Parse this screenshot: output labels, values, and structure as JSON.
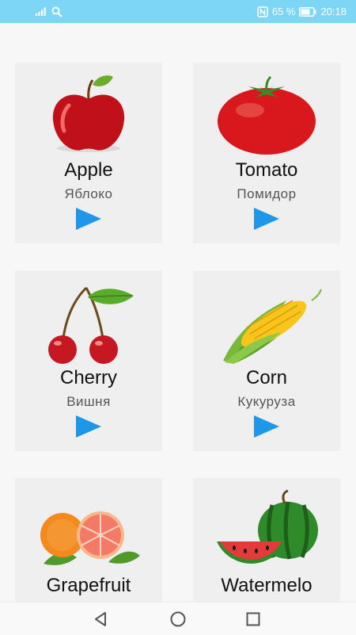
{
  "status_bar": {
    "battery": "65 %",
    "time": "20:18",
    "icons": [
      "signal-icon",
      "search-icon",
      "nfc-icon",
      "battery-icon"
    ]
  },
  "cards": [
    {
      "name": "Apple",
      "translation": "Яблоко",
      "image": "apple-image"
    },
    {
      "name": "Tomato",
      "translation": "Помидор",
      "image": "tomato-image"
    },
    {
      "name": "Cherry",
      "translation": "Вишня",
      "image": "cherry-image"
    },
    {
      "name": "Corn",
      "translation": "Кукуруза",
      "image": "corn-image"
    },
    {
      "name": "Grapefruit",
      "translation": "",
      "image": "grapefruit-image"
    },
    {
      "name": "Watermelo",
      "translation": "",
      "image": "watermelon-image"
    }
  ],
  "nav_bar": {
    "buttons": [
      "back-icon",
      "home-icon",
      "recents-icon"
    ]
  },
  "colors": {
    "status_bar": "#7ed6f6",
    "play": "#1e97e8",
    "card": "#efefef",
    "background": "#f7f7f7"
  }
}
